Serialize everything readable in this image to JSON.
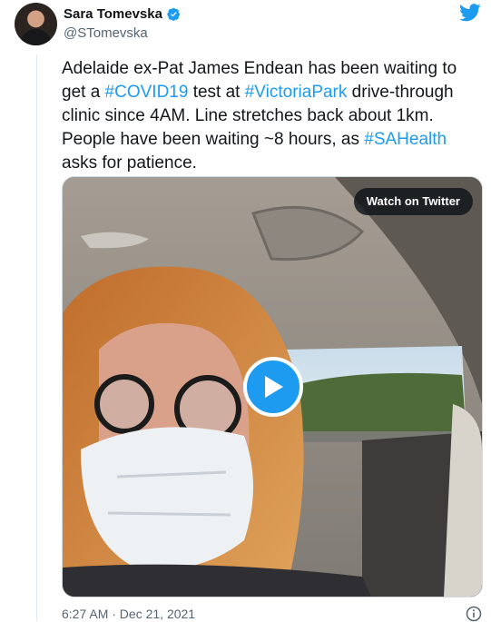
{
  "tweet": {
    "author_name": "Sara Tomevska",
    "author_handle": "@STomevska",
    "verified": true,
    "text_segments": [
      {
        "type": "text",
        "value": "Adelaide ex-Pat James Endean has been waiting to get a "
      },
      {
        "type": "hashtag",
        "value": "#COVID19"
      },
      {
        "type": "text",
        "value": " test at "
      },
      {
        "type": "hashtag",
        "value": "#VictoriaPark"
      },
      {
        "type": "text",
        "value": " drive-through clinic since 4AM. Line stretches back about 1km. People have been waiting ~8 hours, as "
      },
      {
        "type": "hashtag",
        "value": "#SAHealth"
      },
      {
        "type": "text",
        "value": " asks for patience."
      }
    ],
    "timestamp": "6:27 AM · Dec 21, 2021"
  },
  "media": {
    "watch_label": "Watch on Twitter",
    "play_icon": "play-icon"
  },
  "icons": {
    "verified": "verified-badge-icon",
    "brand": "twitter-bird-icon",
    "info": "info-icon"
  },
  "colors": {
    "accent": "#1d9bf0",
    "text": "#14171a",
    "muted": "#536471"
  }
}
